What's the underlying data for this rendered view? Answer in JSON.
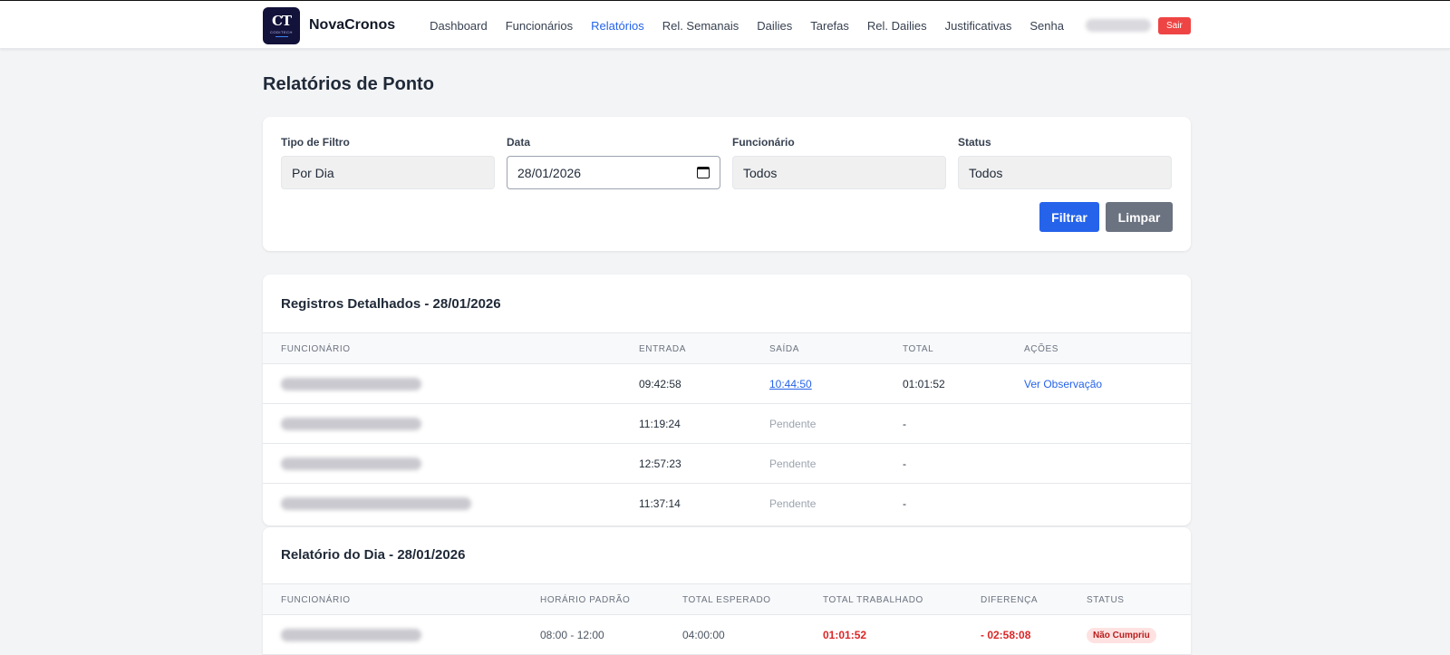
{
  "navbar": {
    "logo_mark": "CT",
    "logo_sub": "CODITECH",
    "brand": "NovaCronos",
    "links": [
      {
        "label": "Dashboard",
        "active": false
      },
      {
        "label": "Funcionários",
        "active": false
      },
      {
        "label": "Relatórios",
        "active": true
      },
      {
        "label": "Rel. Semanais",
        "active": false
      },
      {
        "label": "Dailies",
        "active": false
      },
      {
        "label": "Tarefas",
        "active": false
      },
      {
        "label": "Rel. Dailies",
        "active": false
      },
      {
        "label": "Justificativas",
        "active": false
      },
      {
        "label": "Senha",
        "active": false
      }
    ],
    "logout_label": "Sair"
  },
  "page": {
    "title": "Relatórios de Ponto"
  },
  "filters": {
    "tipo_label": "Tipo de Filtro",
    "tipo_value": "Por Dia",
    "data_label": "Data",
    "data_value": "28/01/2026",
    "funcionario_label": "Funcionário",
    "funcionario_value": "Todos",
    "status_label": "Status",
    "status_value": "Todos",
    "filter_button": "Filtrar",
    "clear_button": "Limpar"
  },
  "detailed": {
    "title": "Registros Detalhados - 28/01/2026",
    "headers": [
      "Funcionário",
      "Entrada",
      "Saída",
      "Total",
      "Ações"
    ],
    "rows": [
      {
        "entrada": "09:42:58",
        "saida": "10:44:50",
        "saida_pending": false,
        "total": "01:01:52",
        "acao": "Ver Observação"
      },
      {
        "entrada": "11:19:24",
        "saida": "Pendente",
        "saida_pending": true,
        "total": "-",
        "acao": ""
      },
      {
        "entrada": "12:57:23",
        "saida": "Pendente",
        "saida_pending": true,
        "total": "-",
        "acao": ""
      },
      {
        "entrada": "11:37:14",
        "saida": "Pendente",
        "saida_pending": true,
        "total": "-",
        "acao": ""
      }
    ]
  },
  "daily": {
    "title": "Relatório do Dia - 28/01/2026",
    "headers": [
      "Funcionário",
      "Horário Padrão",
      "Total Esperado",
      "Total Trabalhado",
      "Diferença",
      "Status"
    ],
    "rows": [
      {
        "horario": "08:00 - 12:00",
        "esperado": "04:00:00",
        "trabalhado": "01:01:52",
        "diferenca": "- 02:58:08",
        "status": "Não Cumpriu"
      }
    ]
  },
  "colors": {
    "accent": "#2563eb",
    "danger": "#ef4444",
    "neutral_button": "#6b7280"
  }
}
